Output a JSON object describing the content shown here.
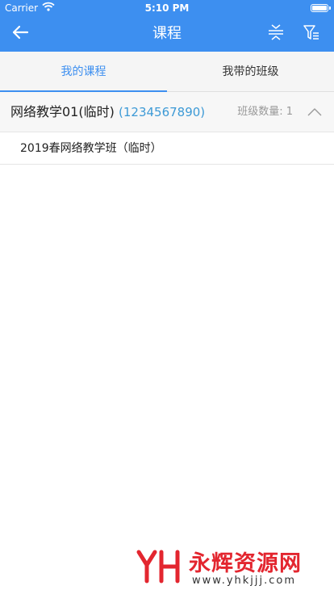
{
  "status_bar": {
    "carrier": "Carrier",
    "time": "5:10 PM"
  },
  "nav": {
    "title": "课程",
    "back_icon": "arrow-left-icon",
    "collapse_icon": "collapse-icon",
    "filter_icon": "filter-icon"
  },
  "tabs": [
    {
      "label": "我的课程",
      "active": true
    },
    {
      "label": "我带的班级",
      "active": false
    }
  ],
  "course": {
    "name": "网络教学01(临时)",
    "code": "(1234567890)",
    "class_count": "班级数量: 1",
    "expanded": true,
    "classes": [
      {
        "name": "2019春网络教学班（临时）"
      }
    ]
  },
  "watermark": {
    "title": "永辉资源网",
    "url": "www.yhkjjj.com"
  },
  "colors": {
    "primary": "#3d8ff0",
    "link": "#3d9ad6",
    "watermark": "#e3262f"
  }
}
